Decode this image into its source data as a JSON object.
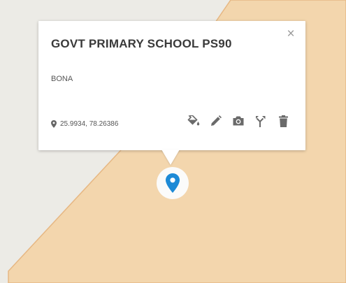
{
  "popup": {
    "title": "GOVT PRIMARY SCHOOL PS90",
    "description": "BONA",
    "coordinates": "25.9934, 78.26386",
    "close_symbol": "×"
  },
  "tools": [
    {
      "icon": "paint-bucket-icon"
    },
    {
      "icon": "pencil-icon"
    },
    {
      "icon": "camera-icon"
    },
    {
      "icon": "route-fork-icon"
    },
    {
      "icon": "trash-icon"
    }
  ],
  "marker": {
    "icon": "map-pin-icon",
    "color": "#1d8ad6"
  },
  "colors": {
    "map_background": "#ecebe6",
    "region_fill": "#f3d6ad",
    "region_border": "#e6b783",
    "icon_gray": "#6a6a6a"
  }
}
